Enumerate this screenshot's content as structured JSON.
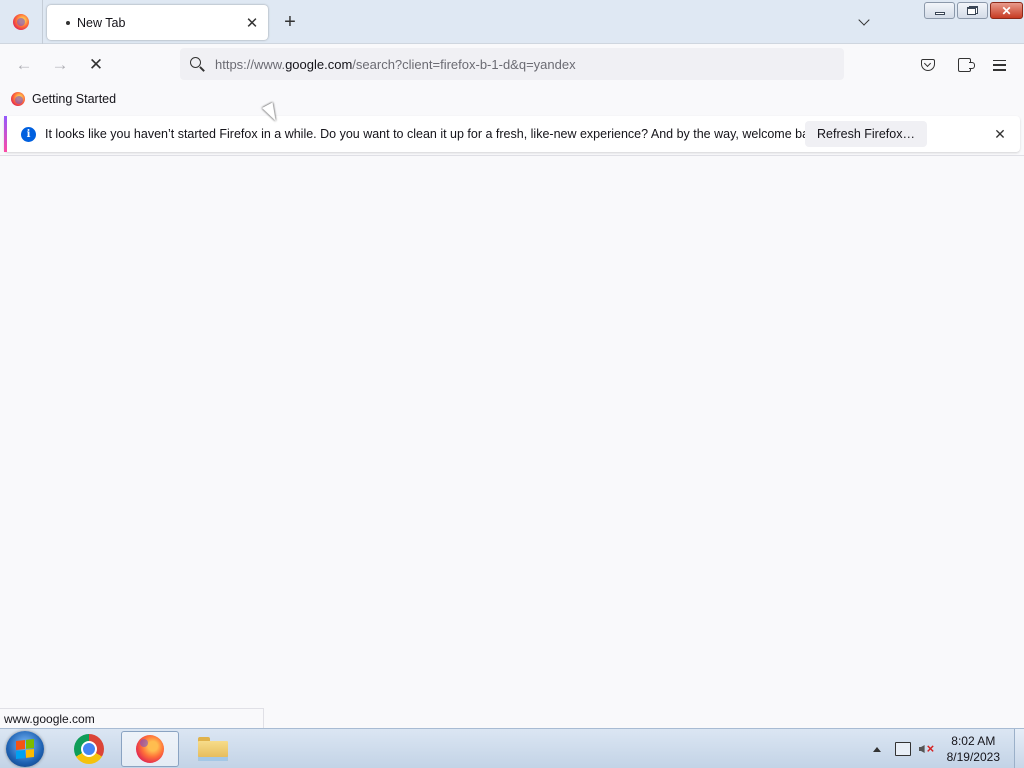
{
  "browser": {
    "tab": {
      "title": "New Tab",
      "close_glyph": "✕"
    },
    "new_tab_glyph": "+",
    "urlbar": {
      "prefix": "https://www.",
      "host": "google.com",
      "suffix": "/search?client=firefox-b-1-d&q=yandex"
    },
    "nav": {
      "back_glyph": "←",
      "forward_glyph": "→",
      "stop_glyph": "✕"
    },
    "bookmarks": [
      {
        "label": "Getting Started"
      }
    ],
    "notification": {
      "message": "It looks like you haven’t started Firefox in a while. Do you want to clean it up for a fresh, like-new experience? And by the way, welcome back!",
      "button": "Refresh Firefox…",
      "close_glyph": "✕",
      "info_glyph": "i"
    },
    "status_text": "www.google.com"
  },
  "window_controls": {
    "close_glyph": "✕"
  },
  "taskbar": {
    "apps": [
      "chrome-icon",
      "firefox-icon",
      "file-explorer-icon"
    ],
    "clock": {
      "time": "8:02 AM",
      "date": "8/19/2023"
    }
  },
  "icons": {
    "firefox": "firefox-logo-icon",
    "search": "search-icon",
    "pocket": "pocket-icon",
    "extensions": "extensions-icon",
    "menu": "hamburger-menu-icon"
  }
}
